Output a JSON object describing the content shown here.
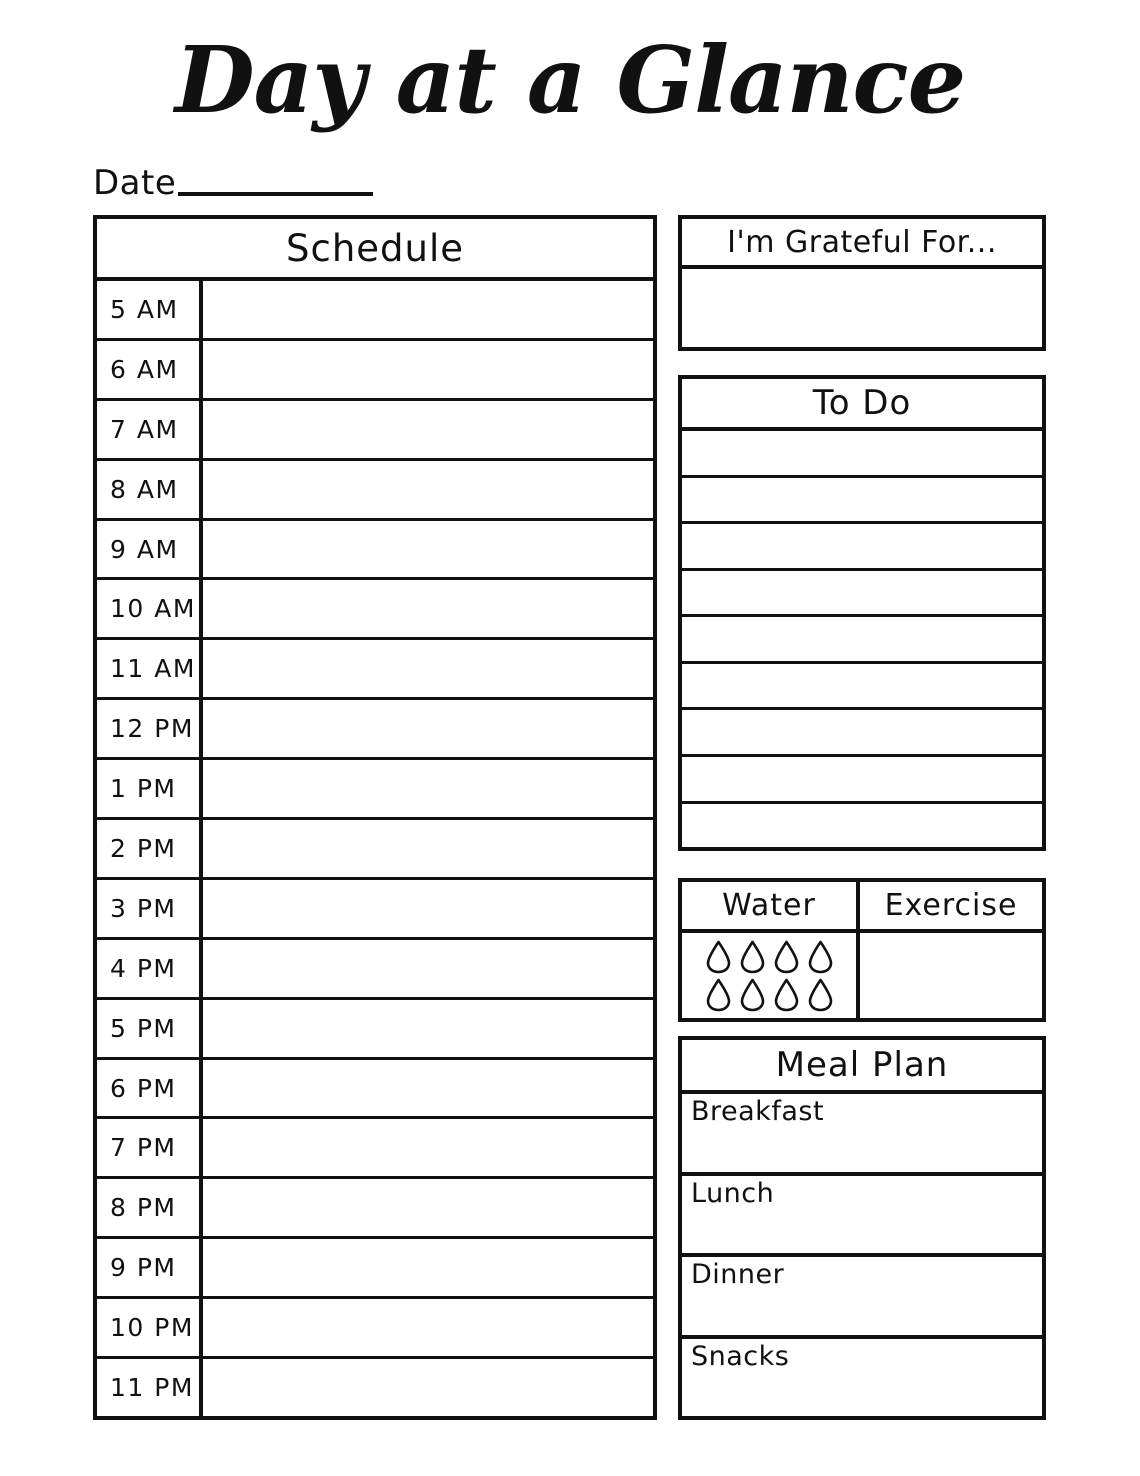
{
  "page": {
    "title": "Day at a Glance",
    "date_label": "Date"
  },
  "schedule": {
    "header": "Schedule",
    "rows": [
      {
        "time": "5 AM",
        "entry": ""
      },
      {
        "time": "6 AM",
        "entry": ""
      },
      {
        "time": "7 AM",
        "entry": ""
      },
      {
        "time": "8 AM",
        "entry": ""
      },
      {
        "time": "9 AM",
        "entry": ""
      },
      {
        "time": "10 AM",
        "entry": ""
      },
      {
        "time": "11 AM",
        "entry": ""
      },
      {
        "time": "12 PM",
        "entry": ""
      },
      {
        "time": "1 PM",
        "entry": ""
      },
      {
        "time": "2 PM",
        "entry": ""
      },
      {
        "time": "3 PM",
        "entry": ""
      },
      {
        "time": "4 PM",
        "entry": ""
      },
      {
        "time": "5 PM",
        "entry": ""
      },
      {
        "time": "6 PM",
        "entry": ""
      },
      {
        "time": "7 PM",
        "entry": ""
      },
      {
        "time": "8 PM",
        "entry": ""
      },
      {
        "time": "9 PM",
        "entry": ""
      },
      {
        "time": "10 PM",
        "entry": ""
      },
      {
        "time": "11 PM",
        "entry": ""
      }
    ]
  },
  "grateful": {
    "header": "I'm Grateful For...",
    "entry": ""
  },
  "todo": {
    "header": "To Do",
    "items": [
      "",
      "",
      "",
      "",
      "",
      "",
      "",
      "",
      ""
    ]
  },
  "tracker": {
    "water": {
      "header": "Water",
      "icon": "water-droplet-icon",
      "droplet_count": 8,
      "droplets_filled": 0
    },
    "exercise": {
      "header": "Exercise",
      "entry": ""
    }
  },
  "meal_plan": {
    "header": "Meal Plan",
    "meals": [
      {
        "label": "Breakfast",
        "entry": ""
      },
      {
        "label": "Lunch",
        "entry": ""
      },
      {
        "label": "Dinner",
        "entry": ""
      },
      {
        "label": "Snacks",
        "entry": ""
      }
    ]
  },
  "colors": {
    "ink": "#111111",
    "paper": "#ffffff"
  }
}
